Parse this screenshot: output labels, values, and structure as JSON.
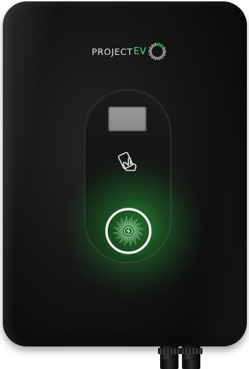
{
  "logo": {
    "text": "PROJECT",
    "accent": "EV"
  },
  "icons": {
    "rfid": "rfid-card-tap-icon",
    "charge": "lightning-bolt-icon"
  },
  "colors": {
    "housing": "#151515",
    "accent_green": "#4ee07a",
    "glow_green": "#46e65a",
    "ring": "#f2f2f2",
    "lcd": "#8f8f8f"
  },
  "status": {
    "charging_light": "green"
  }
}
